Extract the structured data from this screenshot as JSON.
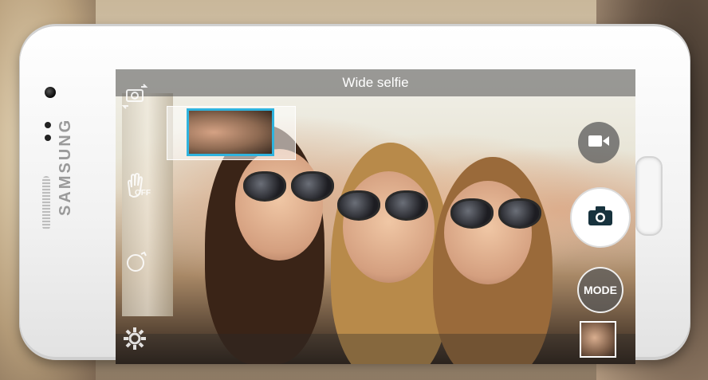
{
  "window": {
    "title": "Wide selfie"
  },
  "device": {
    "brand": "SAMSUNG"
  },
  "controls": {
    "mode_label": "MODE",
    "gesture_state": "OFF"
  },
  "icons": {
    "switch_camera": "switch-camera-icon",
    "gesture": "hand-gesture-icon",
    "beauty": "beauty-face-icon",
    "settings": "gear-icon",
    "video": "video-camera-icon",
    "camera": "camera-icon"
  },
  "colors": {
    "panorama_frame": "#2fb3de",
    "overlay_bar": "#505050"
  }
}
